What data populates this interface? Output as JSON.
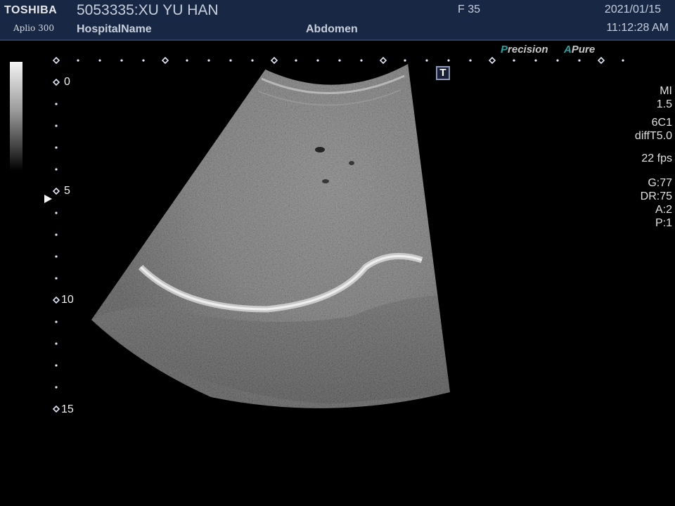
{
  "header": {
    "brand": "TOSHIBA",
    "model": "Aplio 300",
    "patient": "5053335:XU YU HAN",
    "hospital": "HospitalName",
    "preset": "Abdomen",
    "frame": "F  35",
    "date": "2021/01/15",
    "time": "11:12:28 AM"
  },
  "processing": {
    "precision_first": "P",
    "precision_rest": "recision",
    "apure_first": "A",
    "apure_rest": "Pure"
  },
  "t_marker": "T",
  "params": {
    "mi_label": "MI",
    "mi_value": "1.5",
    "probe": "6C1",
    "mode": "diffT5.0",
    "fps": "22 fps",
    "gain": "G:77",
    "dynamic_range": "DR:75",
    "a": "A:2",
    "p": "P:1"
  },
  "depth_scale": {
    "labels": [
      "0",
      "5",
      "10",
      "15"
    ]
  },
  "colors": {
    "header_bg": "#172744",
    "accent_teal": "#2aa3a0",
    "text": "#e6e6e6"
  }
}
